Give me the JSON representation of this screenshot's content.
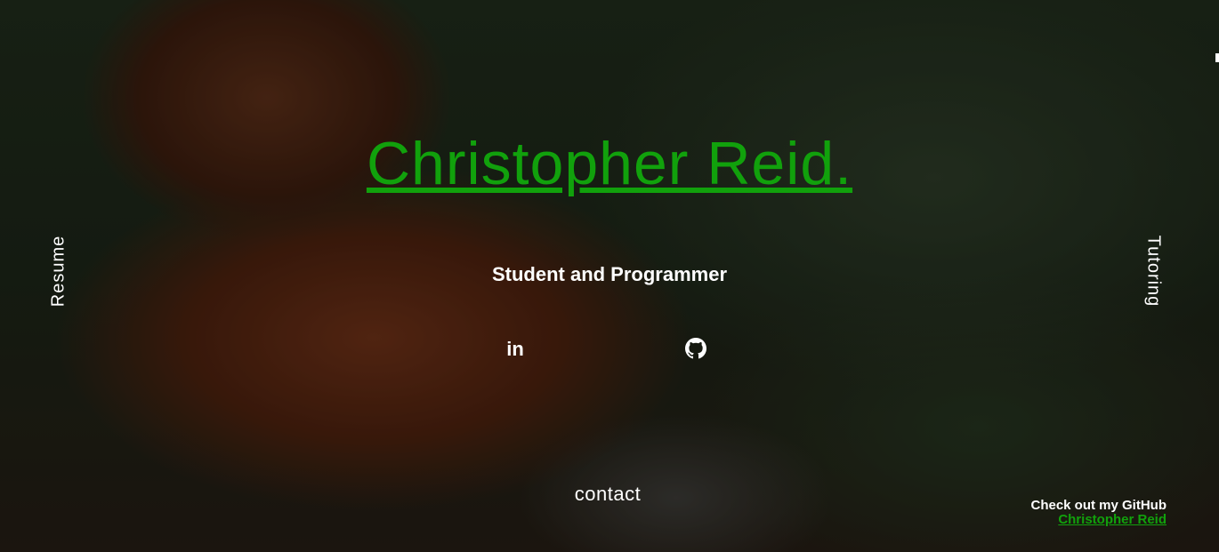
{
  "hero": {
    "title": "Christopher Reid.",
    "subtitle": "Student and Programmer"
  },
  "social": {
    "linkedin_label": "in",
    "linkedin_icon": "linkedin-icon",
    "github_icon": "github-icon"
  },
  "nav": {
    "left_label": "Resume",
    "right_label": "Tutoring",
    "contact_label": "contact"
  },
  "footer": {
    "label": "Check out my GitHub",
    "link_text": "Christopher Reid"
  },
  "colors": {
    "accent": "#11a10c",
    "text": "#ffffff"
  }
}
